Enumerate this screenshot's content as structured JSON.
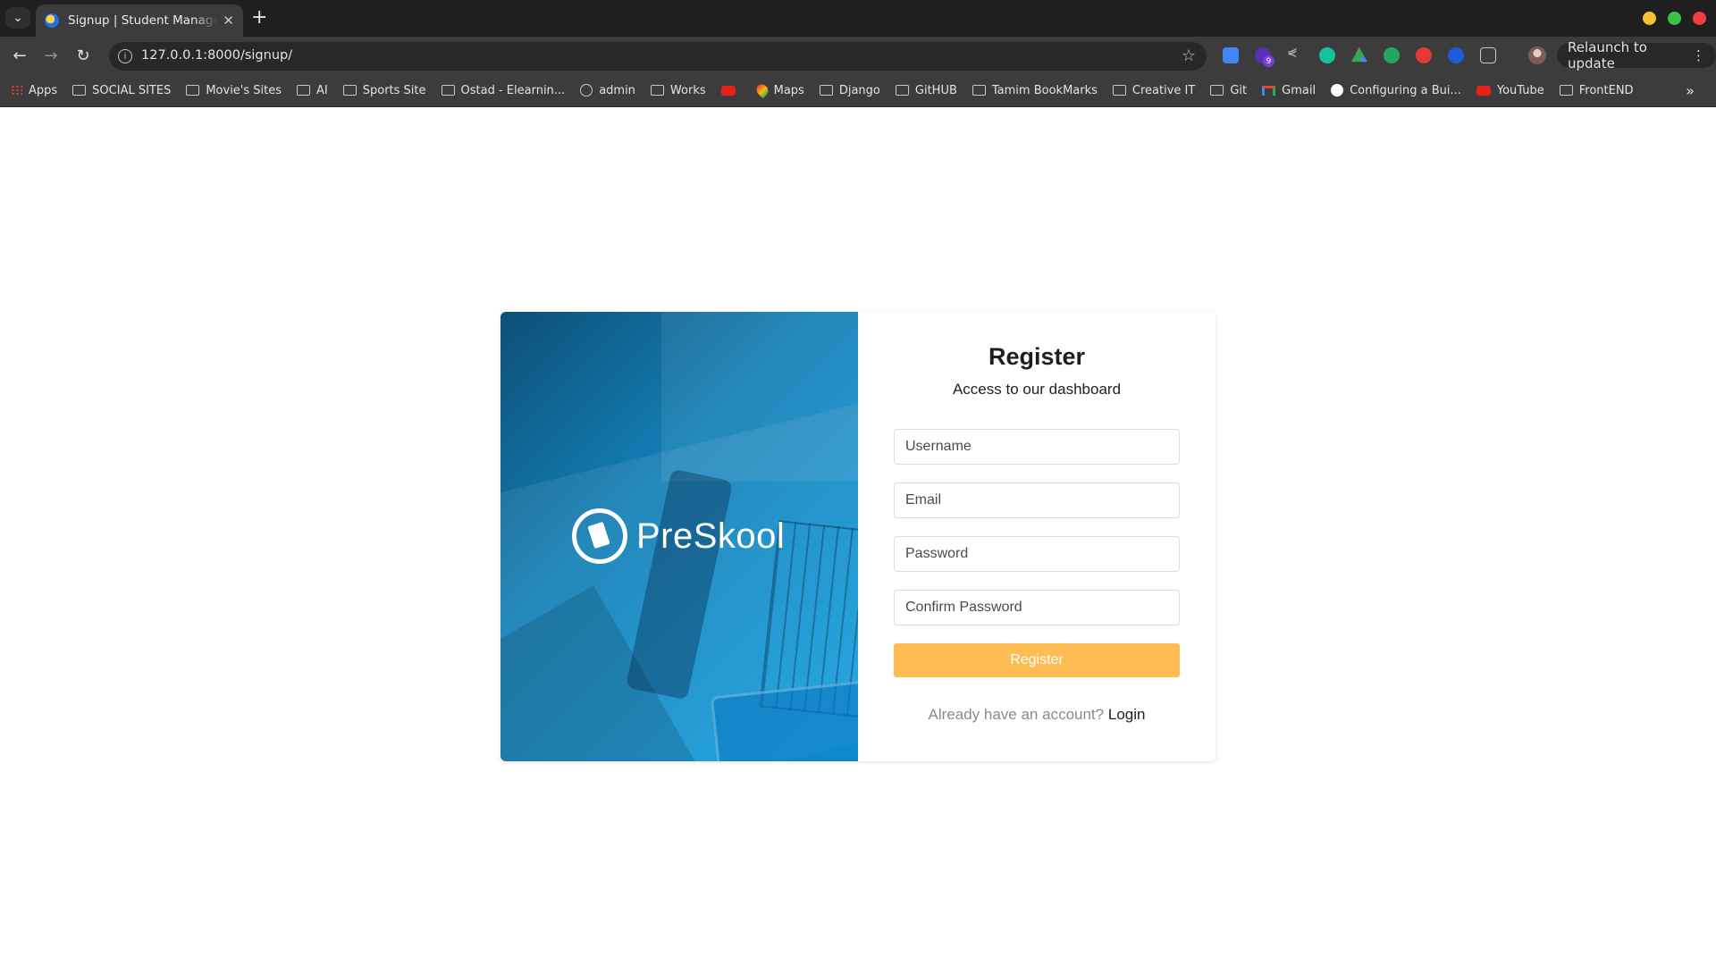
{
  "browser": {
    "tab_title": "Signup | Student Manageme",
    "url": "127.0.0.1:8000/signup/",
    "relaunch_label": "Relaunch to update",
    "extension_badge": "9",
    "window_controls": {
      "minimize_color": "#f5c230",
      "maximize_color": "#3cc04a",
      "close_color": "#ef3f3f"
    },
    "bookmarks": [
      {
        "label": "Apps",
        "icon": "apps-grid-icon"
      },
      {
        "label": "SOCIAL SITES",
        "icon": "folder-icon"
      },
      {
        "label": "Movie's Sites",
        "icon": "folder-icon"
      },
      {
        "label": "AI",
        "icon": "folder-icon"
      },
      {
        "label": "Sports Site",
        "icon": "folder-icon"
      },
      {
        "label": "Ostad - Elearnin...",
        "icon": "folder-icon"
      },
      {
        "label": "admin",
        "icon": "globe-icon"
      },
      {
        "label": "Works",
        "icon": "folder-icon"
      },
      {
        "label": "",
        "icon": "youtube-icon"
      },
      {
        "label": "Maps",
        "icon": "maps-icon"
      },
      {
        "label": "Django",
        "icon": "folder-icon"
      },
      {
        "label": "GitHUB",
        "icon": "folder-icon"
      },
      {
        "label": "Tamim BookMarks",
        "icon": "folder-icon"
      },
      {
        "label": "Creative IT",
        "icon": "folder-icon"
      },
      {
        "label": "Git",
        "icon": "folder-icon"
      },
      {
        "label": "Gmail",
        "icon": "gmail-icon"
      },
      {
        "label": "Configuring a Bui...",
        "icon": "nextjs-icon"
      },
      {
        "label": "YouTube",
        "icon": "youtube-icon"
      },
      {
        "label": "FrontEND",
        "icon": "folder-icon"
      }
    ]
  },
  "signup": {
    "brand": "PreSkool",
    "title": "Register",
    "subtitle": "Access to our dashboard",
    "fields": {
      "username_placeholder": "Username",
      "email_placeholder": "Email",
      "password_placeholder": "Password",
      "confirm_password_placeholder": "Confirm Password"
    },
    "submit_label": "Register",
    "login_prompt": "Already have an account?",
    "login_link": "Login",
    "accent_color": "#ffbc53",
    "panel_color": "#14a1e3"
  }
}
